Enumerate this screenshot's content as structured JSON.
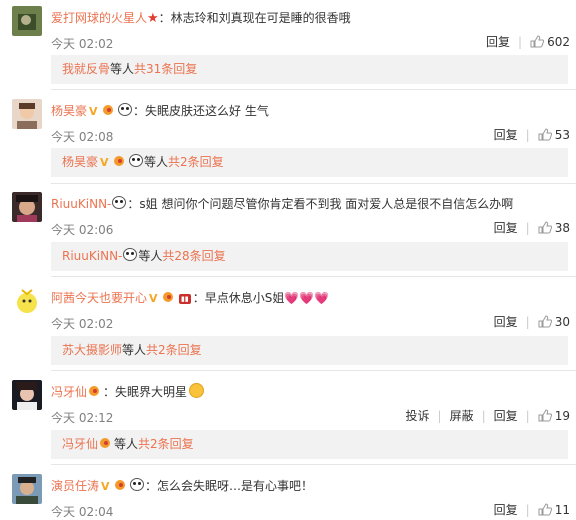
{
  "comments": [
    {
      "user": "爱打网球的火星人",
      "text": "：林志玲和刘真现在可是睡的很香哦",
      "time": "今天 02:02",
      "reply_label": "回复",
      "likes": "602",
      "thread": {
        "who": "我就反骨",
        "tail": "等人",
        "count": "共31条回复"
      }
    },
    {
      "user": "杨昊豪",
      "text": "：失眠皮肤还这么好 生气",
      "time": "今天 02:08",
      "reply_label": "回复",
      "likes": "53",
      "thread": {
        "who": "杨昊豪",
        "tail": "等人",
        "count": "共2条回复"
      }
    },
    {
      "user": "RiuuKiNN-",
      "text": "：s姐 想问你个问题尽管你肯定看不到我 面对爱人总是很不自信怎么办啊",
      "time": "今天 02:06",
      "reply_label": "回复",
      "likes": "38",
      "thread": {
        "who": "RiuuKiNN-",
        "tail": "等人",
        "count": "共28条回复"
      }
    },
    {
      "user": "阿茜今天也要开心",
      "text": "：早点休息小S姐",
      "time": "今天 02:02",
      "reply_label": "回复",
      "likes": "30",
      "thread": {
        "who": "苏大摄影师",
        "tail": "等人",
        "count": "共2条回复"
      }
    },
    {
      "user": "冯牙仙",
      "text": "：失眠界大明星",
      "time": "今天 02:12",
      "report_label": "投诉",
      "block_label": "屏蔽",
      "reply_label": "回复",
      "likes": "19",
      "thread": {
        "who": "冯牙仙",
        "tail": "等人",
        "count": "共2条回复"
      }
    },
    {
      "user": "演员任涛",
      "text": "：怎么会失眠呀…是有心事吧！",
      "time": "今天 02:04",
      "reply_label": "回复",
      "likes": "11"
    }
  ],
  "colors": {
    "username": "#eb7350",
    "thread_bg": "#f2f2f2",
    "time": "#808080"
  }
}
